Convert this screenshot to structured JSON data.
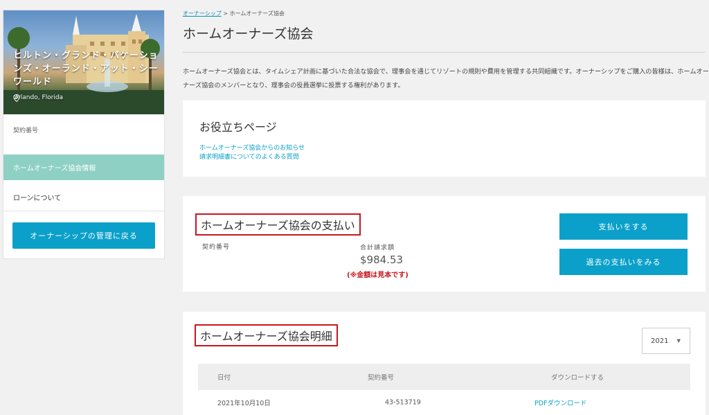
{
  "sidebar": {
    "resort_name": "ヒルトン・グランド・バケーションズ・オーランド・アット・シーワールド",
    "location": "Orlando, Florida",
    "contract_label": "契約番号",
    "items": [
      {
        "label": "ホームオーナーズ協会情報",
        "active": true
      },
      {
        "label": "ローンについて",
        "active": false
      }
    ],
    "back_button": "オーナーシップの管理に戻る"
  },
  "breadcrumb": {
    "parent": "オーナーシップ",
    "separator": ">",
    "current": "ホームオーナーズ協会"
  },
  "page": {
    "title": "ホームオーナーズ協会",
    "intro": "ホームオーナーズ協会とは、タイムシェア計画に基づいた合法な協会で、理事会を通じてリゾートの規則や費用を管理する共同組織です。オーナーシップをご購入の皆様は、ホームオーナーズ協会のメンバーとなり、理事会の役員選挙に投票する権利があります。"
  },
  "useful_pages": {
    "heading": "お役立ちページ",
    "links": [
      "ホームオーナーズ協会からのお知らせ",
      "請求明細書についてのよくある質問"
    ]
  },
  "payment": {
    "heading": "ホームオーナーズ協会の支払い",
    "contract_label": "契約番号",
    "total_label": "合計請求額",
    "amount": "$984.53",
    "sample_note": "(※金額は見本です)",
    "pay_button": "支払いをする",
    "past_button": "過去の支払いをみる"
  },
  "statement": {
    "heading": "ホームオーナーズ協会明細",
    "year": "2021",
    "columns": [
      "日付",
      "契約番号",
      "ダウンロードする"
    ],
    "rows": [
      {
        "date": "2021年10月10日",
        "contract": "43-513719",
        "download": "PDFダウンロード"
      }
    ]
  },
  "colors": {
    "accent": "#0ba0c9",
    "active_nav": "#8fd0c5",
    "highlight_border": "#c8161d"
  }
}
